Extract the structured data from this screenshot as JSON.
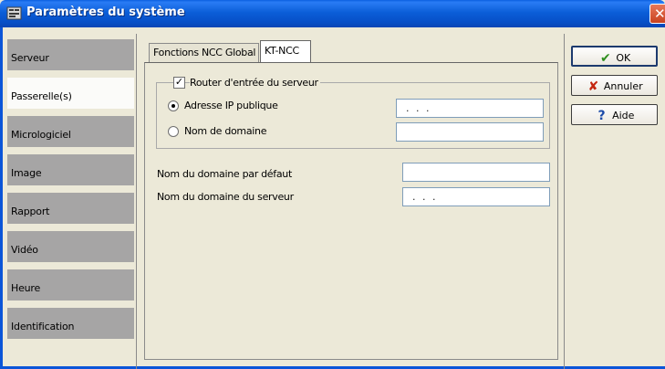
{
  "window": {
    "title": "Paramètres du système",
    "close_glyph": "✕"
  },
  "sidebar": {
    "items": [
      {
        "label": "Serveur",
        "active": false
      },
      {
        "label": "Passerelle(s)",
        "active": true
      },
      {
        "label": "Micrologiciel",
        "active": false
      },
      {
        "label": "Image",
        "active": false
      },
      {
        "label": "Rapport",
        "active": false
      },
      {
        "label": "Vidéo",
        "active": false
      },
      {
        "label": "Heure",
        "active": false
      },
      {
        "label": "Identification",
        "active": false
      }
    ]
  },
  "tabs": [
    {
      "label": "Fonctions NCC Global",
      "active": false
    },
    {
      "label": "KT-NCC",
      "active": true
    }
  ],
  "kt_ncc": {
    "router_checkbox": {
      "label": "Router d'entrée du serveur",
      "checked": true
    },
    "public_ip": {
      "label": "Adresse IP publique",
      "selected": true,
      "value": ". . ."
    },
    "domain_name": {
      "label": "Nom de domaine",
      "selected": false,
      "value": ""
    },
    "default_domain": {
      "label": "Nom du domaine par défaut",
      "value": ""
    },
    "server_domain": {
      "label": "Nom du domaine du serveur",
      "value": ". . ."
    }
  },
  "buttons": {
    "ok": {
      "label": "OK",
      "icon": "check-icon",
      "color": "#2f8f1e"
    },
    "cancel": {
      "label": "Annuler",
      "icon": "x-icon",
      "color": "#c4260f"
    },
    "help": {
      "label": "Aide",
      "icon": "question-icon",
      "color": "#1b4aa8"
    }
  }
}
